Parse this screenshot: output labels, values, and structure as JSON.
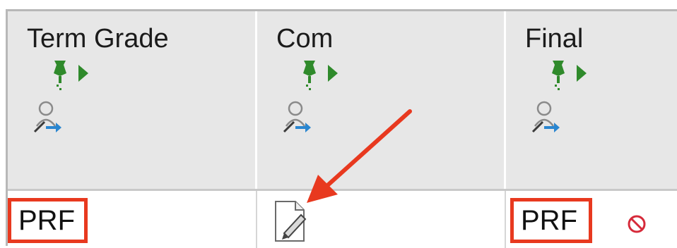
{
  "columns": [
    {
      "header": "Term Grade",
      "pin_icon": "pin-icon",
      "person_icon": "person-edit-icon",
      "cell_value": "PRF"
    },
    {
      "header": "Com",
      "pin_icon": "pin-icon",
      "person_icon": "person-edit-icon",
      "cell_icon": "document-edit-icon"
    },
    {
      "header": "Final",
      "pin_icon": "pin-icon",
      "person_icon": "person-edit-icon",
      "cell_value": "PRF",
      "cell_icon": "no-entry-icon"
    }
  ],
  "annotation": {
    "arrow_color": "#e8391f",
    "highlight_color": "#e8391f"
  },
  "colors": {
    "header_bg": "#e7e7e7",
    "pin": "#2f8a2b",
    "highlight": "#e8391f"
  }
}
